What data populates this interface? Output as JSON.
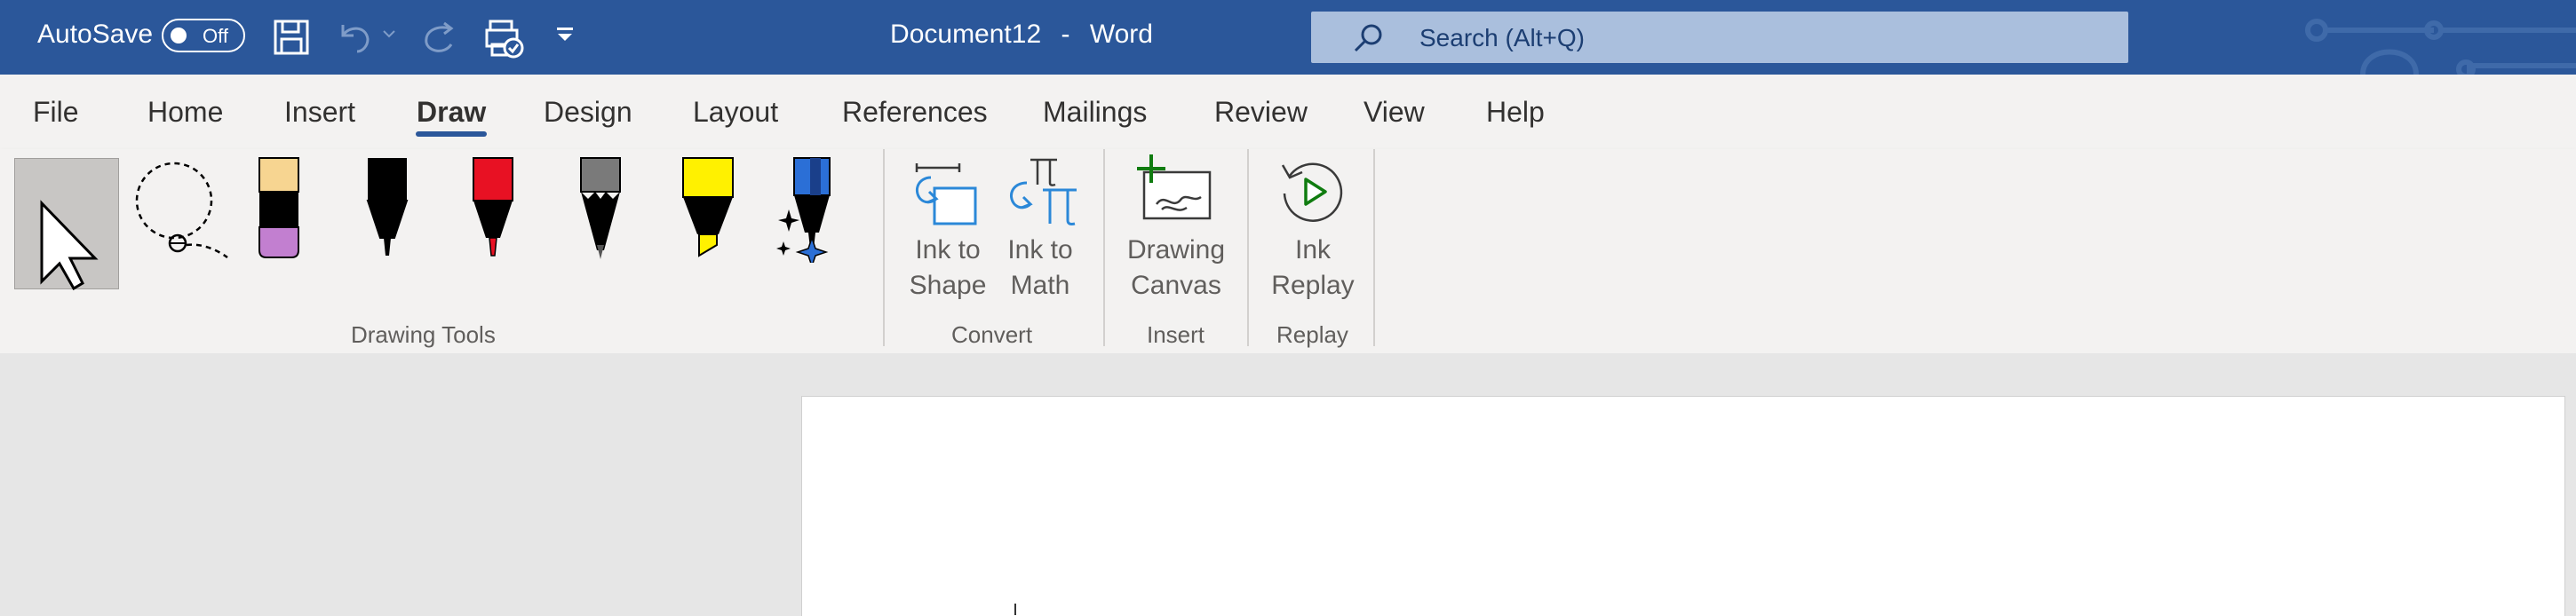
{
  "titlebar": {
    "autosave_label": "AutoSave",
    "autosave_state": "Off",
    "document_name": "Document12",
    "separator": "-",
    "app_name": "Word",
    "search_placeholder": "Search (Alt+Q)",
    "icons": [
      "save-icon",
      "undo-icon",
      "redo-icon",
      "touch-mode-icon",
      "customize-toolbar-icon",
      "search-icon"
    ]
  },
  "tabs": [
    "File",
    "Home",
    "Insert",
    "Draw",
    "Design",
    "Layout",
    "References",
    "Mailings",
    "Review",
    "View",
    "Help"
  ],
  "active_tab": "Draw",
  "ribbon": {
    "groups": {
      "drawing_tools": "Drawing Tools",
      "convert": "Convert",
      "insert": "Insert",
      "replay": "Replay"
    },
    "buttons": {
      "ink_to_shape": [
        "Ink to",
        "Shape"
      ],
      "ink_to_math": [
        "Ink to",
        "Math"
      ],
      "drawing_canvas": [
        "Drawing",
        "Canvas"
      ],
      "ink_replay": [
        "Ink",
        "Replay"
      ]
    },
    "pens": [
      {
        "name": "eraser",
        "color": "#f7d591"
      },
      {
        "name": "black-pen",
        "color": "#000000"
      },
      {
        "name": "red-pen",
        "color": "#e81123"
      },
      {
        "name": "pencil",
        "color": "#7a7a7a"
      },
      {
        "name": "yellow-highlighter",
        "color": "#fff100"
      },
      {
        "name": "galaxy-pen",
        "color": "#2b6fd6"
      }
    ]
  }
}
